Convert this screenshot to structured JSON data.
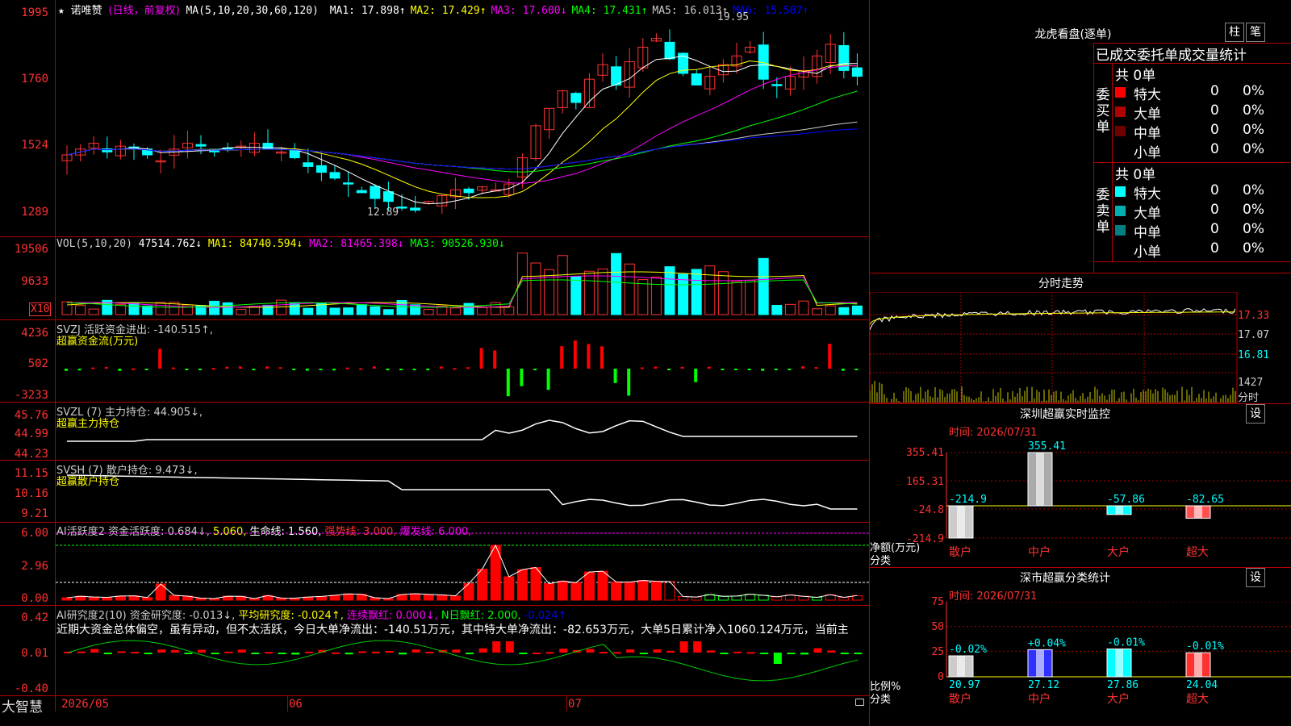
{
  "stock": {
    "name": "诺唯赞",
    "period": "(日线，前复权)",
    "star": "★"
  },
  "colors": {
    "up": "#ff3232",
    "down": "#00ffff",
    "bg": "#000000",
    "grid": "#b00000",
    "ma1": "#ffffff",
    "ma2": "#ffff00",
    "ma3": "#ff00ff",
    "ma4": "#00ff00",
    "ma5": "#cccccc",
    "ma6": "#0000ff"
  },
  "main": {
    "ma_label": "MA(5,10,20,30,60,120)",
    "ma": [
      {
        "label": "MA1:",
        "value": "17.898↑",
        "color": "#ffffff"
      },
      {
        "label": "MA2:",
        "value": "17.429↑",
        "color": "#ffff00"
      },
      {
        "label": "MA3:",
        "value": "17.600↓",
        "color": "#ff00ff"
      },
      {
        "label": "MA4:",
        "value": "17.431↑",
        "color": "#00ff00"
      },
      {
        "label": "MA5:",
        "value": "16.013↑",
        "color": "#cccccc"
      },
      {
        "label": "MA6:",
        "value": "15.507↑",
        "color": "#0000ff"
      }
    ],
    "yticks": [
      "1995",
      "1760",
      "1524",
      "1289"
    ],
    "high_label": "19.95",
    "low_label": "12.89"
  },
  "vol": {
    "label": "VOL(5,10,20)",
    "value": "47514.762↓",
    "ma1": "MA1: 84740.594↓",
    "ma2": "MA2: 81465.398↓",
    "ma3": "MA3: 90526.930↓",
    "yticks": [
      "19506",
      "9633"
    ],
    "unit": "X10"
  },
  "svzj": {
    "label": "SVZJ  活跃资金进出: -140.515↑,",
    "sub": "超赢资金流(万元)",
    "yticks": [
      "4236",
      "502",
      "-3233"
    ]
  },
  "svzl": {
    "label": "SVZL (7) 主力持仓: 44.905↓,",
    "sub": "超赢主力持仓",
    "yticks": [
      "45.76",
      "44.99",
      "44.23"
    ]
  },
  "svsh": {
    "label": "SVSH (7) 散户持仓: 9.473↓,",
    "sub": "超赢散户持仓",
    "yticks": [
      "11.15",
      "10.16",
      "9.21"
    ]
  },
  "ai1": {
    "label": "AI活跃度2 资金活跃度: 0.684↓,",
    "v2": "5.060,",
    "v3": "生命线: 1.560,",
    "v4": "强势线: 3.000,",
    "v5": "爆发线: 6.000,",
    "yticks": [
      "6.00",
      "2.96",
      "0.00"
    ]
  },
  "ai2": {
    "label": "AI研究度2(10) 资金研究度: -0.013↓,",
    "v2": "平均研究度: -0.024↑,",
    "v3": "连续飘红: 0.000↓,",
    "v4": "N日飘红: 2.000,",
    "v5": "-0.024↑",
    "yticks": [
      "0.42",
      "0.01",
      "-0.40"
    ],
    "text": "近期大资金总体偏空，虽有异动，但不太活跃，今日大单净流出：-140.51万元，其中特大单净流出：-82.653万元，大单5日累计净入1060.124万元，当前主"
  },
  "dates": [
    "2026/05",
    "06",
    "07"
  ],
  "brand": "大智慧",
  "lhb": {
    "title": "龙虎看盘(逐单)",
    "btn1": "柱",
    "btn2": "笔",
    "header": "已成交委托单成交量统计",
    "buy_side": "委买单",
    "sell_side": "委卖单",
    "buy_total": "共 0单",
    "sell_total": "共 0单",
    "buy": [
      {
        "name": "特大",
        "count": "0",
        "pct": "0%",
        "color": "#ff0000"
      },
      {
        "name": "大单",
        "count": "0",
        "pct": "0%",
        "color": "#b00000"
      },
      {
        "name": "中单",
        "count": "0",
        "pct": "0%",
        "color": "#6e0000"
      },
      {
        "name": "小单",
        "count": "0",
        "pct": "0%",
        "color": "#000000"
      }
    ],
    "sell": [
      {
        "name": "特大",
        "count": "0",
        "pct": "0%",
        "color": "#00ffff"
      },
      {
        "name": "大单",
        "count": "0",
        "pct": "0%",
        "color": "#00b0b0"
      },
      {
        "name": "中单",
        "count": "0",
        "pct": "0%",
        "color": "#008080"
      },
      {
        "name": "小单",
        "count": "0",
        "pct": "0%",
        "color": "#000000"
      }
    ]
  },
  "fenshi": {
    "title": "分时走势",
    "yticks": [
      "17.33",
      "17.07",
      "16.81"
    ],
    "vol_tick": "1427",
    "vol_label": "分时"
  },
  "szmon": {
    "title": "深圳超赢实时监控",
    "btn": "设",
    "time": "时间: 2026/07/31",
    "yticks": [
      "355.41",
      "165.31",
      "-24.8",
      "-214.9"
    ],
    "ylabel": "净额(万元)",
    "xlabel": "分类",
    "cats": [
      "散户",
      "中户",
      "大户",
      "超大"
    ],
    "values": [
      -214.9,
      355.41,
      -57.86,
      -82.65
    ],
    "value_labels": [
      "-214.9",
      "355.41",
      "-57.86",
      "-82.65"
    ]
  },
  "szcls": {
    "title": "深市超赢分类统计",
    "btn": "设",
    "time": "时间: 2026/07/31",
    "yticks": [
      "75",
      "50",
      "25",
      "0"
    ],
    "ylabel": "比例%",
    "xlabel": "分类",
    "cats": [
      "散户",
      "中户",
      "大户",
      "超大"
    ],
    "values": [
      20.97,
      27.12,
      27.86,
      24.04
    ],
    "changes": [
      "-0.02%",
      "+0.04%",
      "-0.01%",
      "-0.01%"
    ],
    "value_labels": [
      "20.97",
      "27.12",
      "27.86",
      "24.04"
    ]
  }
}
